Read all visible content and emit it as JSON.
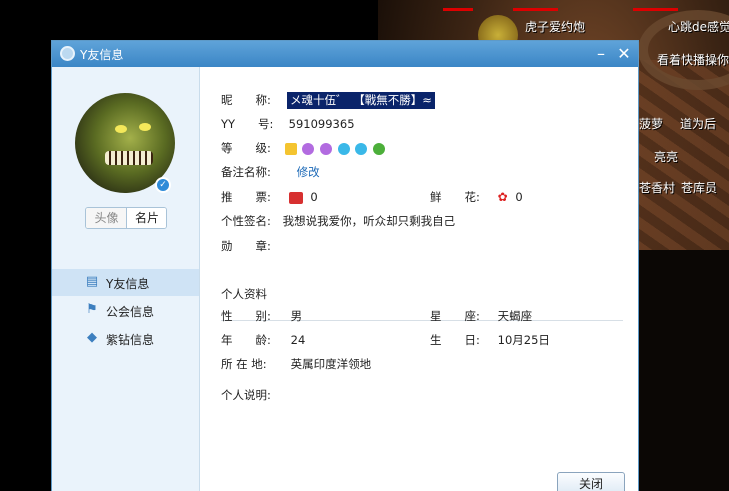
{
  "window": {
    "title": "Y友信息"
  },
  "sidebar": {
    "tabs": [
      "头像",
      "名片"
    ],
    "nav": [
      {
        "label": "Y友信息",
        "icon": "id-card-icon"
      },
      {
        "label": "公会信息",
        "icon": "flag-icon"
      },
      {
        "label": "紫钻信息",
        "icon": "diamond-icon"
      }
    ]
  },
  "profile": {
    "nick_label": "昵　　称:",
    "nick": "メ魂十伍゛　【戰無不勝】≈",
    "yy_label": "YY　　号:",
    "yy": "591099365",
    "level_label": "等　　级:",
    "remark_label": "备注名称:",
    "remark_link": "修改",
    "votes_label": "推　　票:",
    "votes": "0",
    "flowers_label": "鲜　　花:",
    "flowers": "0",
    "signature_label": "个性签名:",
    "signature": "我想说我爱你，听众却只剩我自己",
    "medal_label": "勋　　章:"
  },
  "personal": {
    "section_title": "个人资料",
    "gender_label": "性　　别:",
    "gender": "男",
    "zodiac_label": "星　　座:",
    "zodiac": "天蝎座",
    "age_label": "年　　龄:",
    "age": "24",
    "birthday_label": "生　　日:",
    "birthday": "10月25日",
    "location_label": "所 在 地:",
    "location": "英属印度洋领地",
    "description_label": "个人说明:"
  },
  "buttons": {
    "close": "关闭"
  },
  "game": {
    "names": [
      "虎子爱约炮",
      "心跳de感觉",
      "看着快播操你",
      "菠萝",
      "道为后",
      "亮亮",
      "苍香村",
      "苍库员"
    ]
  },
  "colors": {
    "titlebar": "#4a93d0",
    "nick_highlight": "#0a246a",
    "accent": "#1f6bb8"
  }
}
